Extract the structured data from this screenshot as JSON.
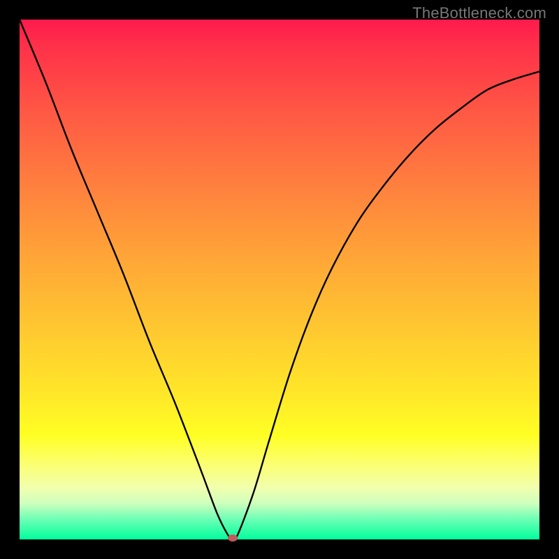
{
  "watermark": "TheBottleneck.com",
  "chart_data": {
    "type": "line",
    "title": "",
    "xlabel": "",
    "ylabel": "",
    "xlim": [
      0,
      100
    ],
    "ylim": [
      0,
      100
    ],
    "series": [
      {
        "name": "bottleneck-curve",
        "x": [
          0,
          5,
          10,
          15,
          20,
          25,
          30,
          35,
          38,
          40,
          41,
          42,
          45,
          48,
          52,
          56,
          60,
          65,
          70,
          75,
          80,
          85,
          90,
          95,
          100
        ],
        "values": [
          100,
          88,
          75,
          63,
          51,
          38,
          26,
          13,
          5,
          1,
          0,
          1,
          9,
          19,
          32,
          43,
          52,
          61,
          68,
          74,
          79,
          83,
          86.5,
          88.5,
          90
        ]
      }
    ],
    "marker": {
      "x": 41,
      "y": 0,
      "color": "#c45a5a"
    },
    "background_gradient": {
      "type": "vertical",
      "stops": [
        {
          "pos": 0.0,
          "color": "#ff1a4d"
        },
        {
          "pos": 0.18,
          "color": "#ff5944"
        },
        {
          "pos": 0.46,
          "color": "#ffa637"
        },
        {
          "pos": 0.72,
          "color": "#ffe729"
        },
        {
          "pos": 0.88,
          "color": "#f8ff8f"
        },
        {
          "pos": 1.0,
          "color": "#00ff9c"
        }
      ]
    }
  }
}
